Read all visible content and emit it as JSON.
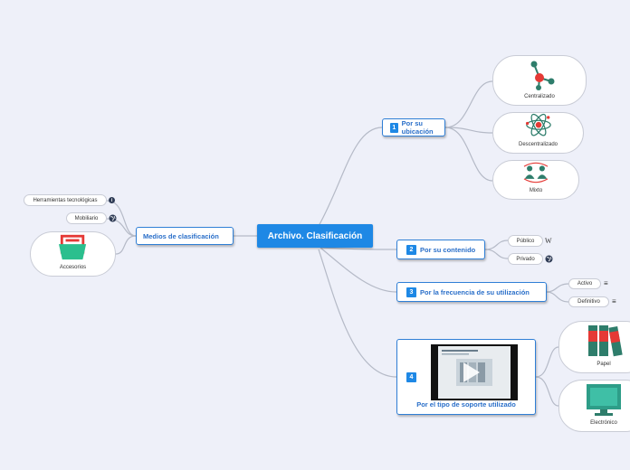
{
  "central": "Archivo. Clasificación",
  "left": {
    "label": "Medios de clasificación",
    "children": [
      "Herramientas tecnológicas",
      "Mobiliario",
      "Accesorios"
    ]
  },
  "right": [
    {
      "badge": "1",
      "label": "Por su ubicación",
      "children": [
        "Centralizado",
        "Descentralizado",
        "Mixto"
      ]
    },
    {
      "badge": "2",
      "label": "Por su contenido",
      "children": [
        "Público",
        "Privado"
      ]
    },
    {
      "badge": "3",
      "label": "Por la frecuencia de su utilización",
      "children": [
        "Activo",
        "Definitivo"
      ]
    },
    {
      "badge": "4",
      "label": "Por el tipo de soporte utilizado",
      "children": [
        "Papel",
        "Electrónico"
      ]
    }
  ],
  "markers": {
    "info": "i",
    "wiki": "W",
    "list": "≡"
  },
  "colors": {
    "central": "#1e88e5",
    "line": "#b5bac7",
    "accent": "#2a6fc9"
  },
  "icons": [
    "network-icon",
    "atom-icon",
    "people-swap-icon",
    "folder-icon",
    "globe-icon",
    "binders-icon",
    "monitor-icon",
    "play-icon"
  ]
}
